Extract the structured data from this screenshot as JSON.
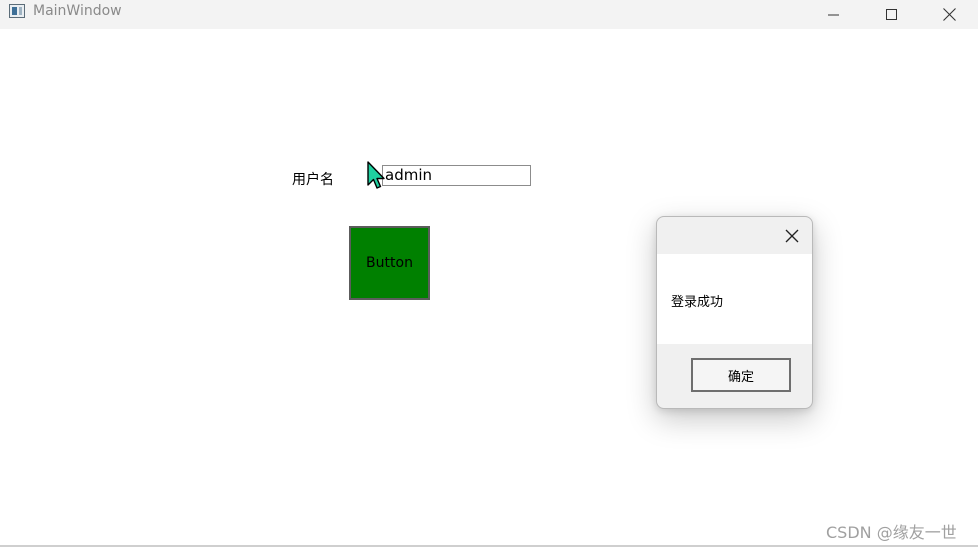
{
  "window": {
    "title": "MainWindow",
    "controls": [
      "minimize-icon",
      "maximize-icon",
      "close-icon"
    ]
  },
  "form": {
    "username_label": "用户名",
    "username_value": "admin",
    "button_label": "Button",
    "button_color": "#008000"
  },
  "dialog": {
    "message": "登录成功",
    "ok_label": "确定"
  },
  "watermark": "CSDN @缘友一世"
}
